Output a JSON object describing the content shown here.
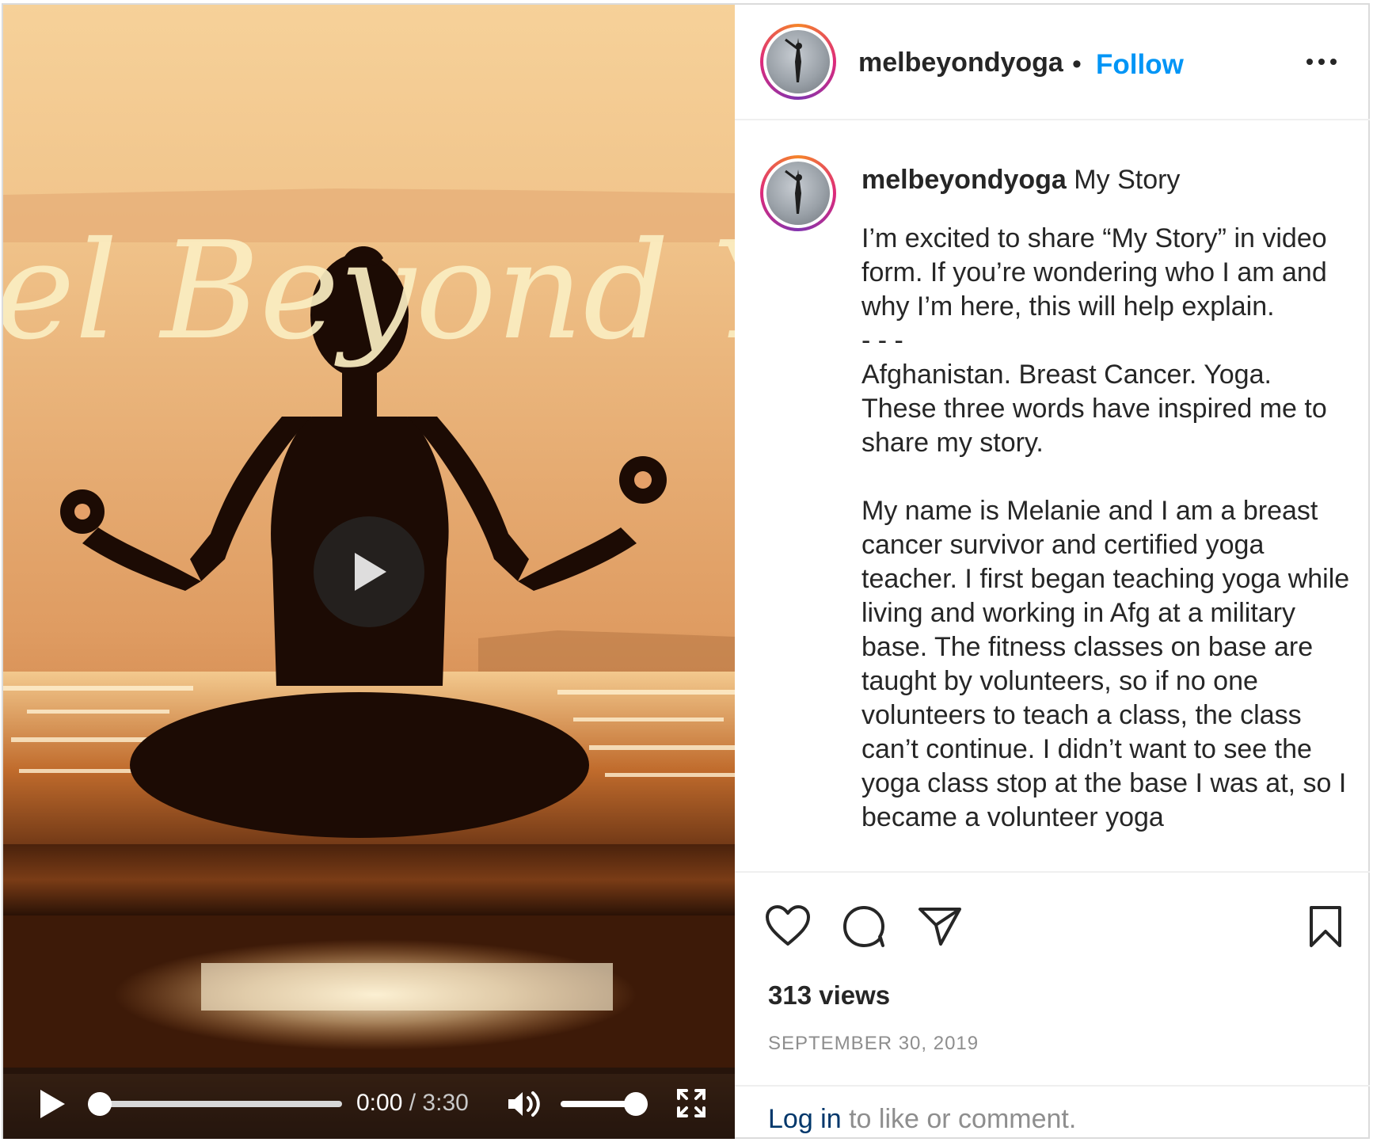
{
  "video": {
    "overlay_title": "el Beyond Yog",
    "current_time": "0:00",
    "separator": "/",
    "duration": "3:30",
    "progress_fraction": 0.0,
    "volume_fraction": 0.95
  },
  "header": {
    "username": "melbeyondyoga",
    "dot": "•",
    "follow_label": "Follow"
  },
  "caption": {
    "username": "melbeyondyoga",
    "title": "My Story",
    "body": "I’m excited to share “My Story” in video form. If you’re wondering who I am and why I’m here, this will help explain.\n- - -\nAfghanistan. Breast Cancer. Yoga. These three words have inspired me to share my story.\n\nMy name is Melanie and I am a breast cancer survivor and certified yoga teacher. I first began teaching yoga while living and working in Afg at a military base. The fitness classes on base are taught by volunteers, so if no one volunteers to teach a class, the class can’t continue. I didn’t want to see the yoga class stop at the base I was at, so I became a volunteer yoga"
  },
  "stats": {
    "views": "313 views",
    "date": "SEPTEMBER 30, 2019"
  },
  "login": {
    "link": "Log in",
    "rest": " to like or comment."
  },
  "icons": {
    "like": "heart-icon",
    "comment": "comment-icon",
    "share": "paper-plane-icon",
    "save": "bookmark-icon",
    "more": "more-dots-icon",
    "play": "play-icon",
    "volume": "volume-icon",
    "fullscreen": "fullscreen-icon"
  },
  "colors": {
    "follow": "#0095f6",
    "muted_text": "#8e8e8e",
    "link": "#00376b"
  }
}
